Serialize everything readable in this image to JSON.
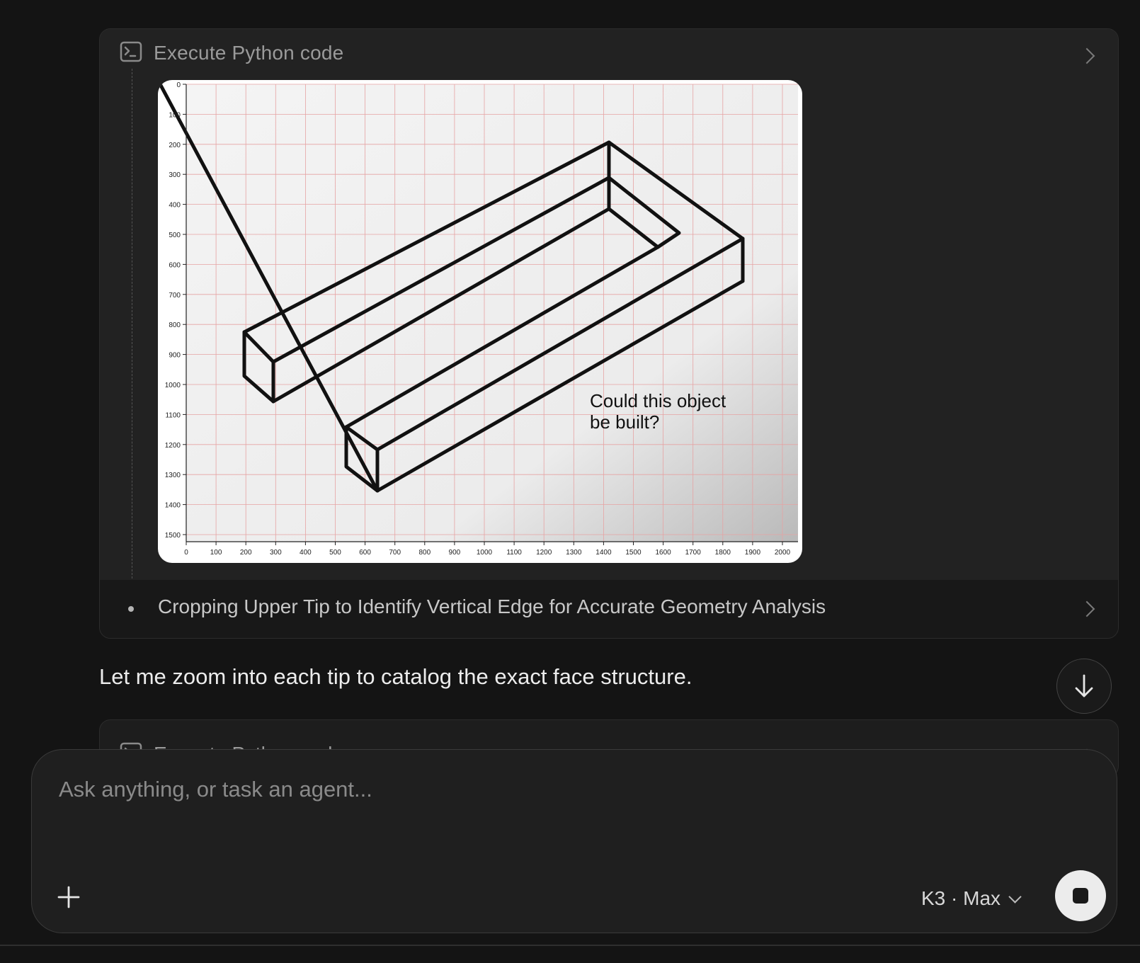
{
  "colors": {
    "background": "#141414",
    "card": "#1d1d1d",
    "text_primary": "#ececec",
    "text_muted": "#9a9a9a",
    "grid_red": "#e6a3a3"
  },
  "tool_call": {
    "label": "Execute Python code",
    "icon": "terminal-icon"
  },
  "plot": {
    "x_ticks": [
      "0",
      "100",
      "200",
      "300",
      "400",
      "500",
      "600",
      "700",
      "800",
      "900",
      "1000",
      "1100",
      "1200",
      "1300",
      "1400",
      "1500",
      "1600",
      "1700",
      "1800",
      "1900",
      "2000"
    ],
    "y_ticks": [
      "0",
      "100",
      "200",
      "300",
      "400",
      "500",
      "600",
      "700",
      "800",
      "900",
      "1000",
      "1100",
      "1200",
      "1300",
      "1400",
      "1500"
    ],
    "caption_line1": "Could this object",
    "caption_line2": "be built?"
  },
  "step": {
    "label": "Cropping Upper Tip to Identify Vertical Edge for Accurate Geometry Analysis"
  },
  "assistant_message": "Let me zoom into each tip to catalog the exact face structure.",
  "tool_call_2": {
    "label": "Execute Python code",
    "icon": "terminal-icon"
  },
  "composer": {
    "placeholder": "Ask anything, or task an agent...",
    "model": "K3 · Max"
  }
}
